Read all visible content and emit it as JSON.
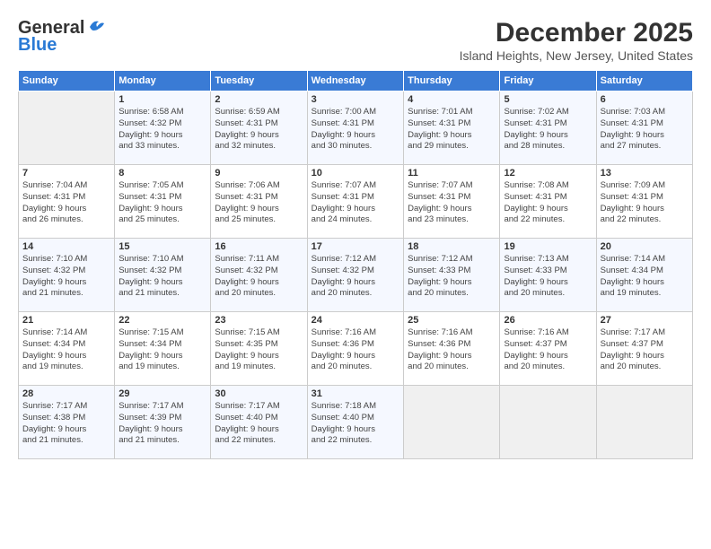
{
  "logo": {
    "general": "General",
    "blue": "Blue"
  },
  "title": "December 2025",
  "location": "Island Heights, New Jersey, United States",
  "days_of_week": [
    "Sunday",
    "Monday",
    "Tuesday",
    "Wednesday",
    "Thursday",
    "Friday",
    "Saturday"
  ],
  "weeks": [
    [
      {
        "day": "",
        "info": ""
      },
      {
        "day": "1",
        "info": "Sunrise: 6:58 AM\nSunset: 4:32 PM\nDaylight: 9 hours\nand 33 minutes."
      },
      {
        "day": "2",
        "info": "Sunrise: 6:59 AM\nSunset: 4:31 PM\nDaylight: 9 hours\nand 32 minutes."
      },
      {
        "day": "3",
        "info": "Sunrise: 7:00 AM\nSunset: 4:31 PM\nDaylight: 9 hours\nand 30 minutes."
      },
      {
        "day": "4",
        "info": "Sunrise: 7:01 AM\nSunset: 4:31 PM\nDaylight: 9 hours\nand 29 minutes."
      },
      {
        "day": "5",
        "info": "Sunrise: 7:02 AM\nSunset: 4:31 PM\nDaylight: 9 hours\nand 28 minutes."
      },
      {
        "day": "6",
        "info": "Sunrise: 7:03 AM\nSunset: 4:31 PM\nDaylight: 9 hours\nand 27 minutes."
      }
    ],
    [
      {
        "day": "7",
        "info": "Sunrise: 7:04 AM\nSunset: 4:31 PM\nDaylight: 9 hours\nand 26 minutes."
      },
      {
        "day": "8",
        "info": "Sunrise: 7:05 AM\nSunset: 4:31 PM\nDaylight: 9 hours\nand 25 minutes."
      },
      {
        "day": "9",
        "info": "Sunrise: 7:06 AM\nSunset: 4:31 PM\nDaylight: 9 hours\nand 25 minutes."
      },
      {
        "day": "10",
        "info": "Sunrise: 7:07 AM\nSunset: 4:31 PM\nDaylight: 9 hours\nand 24 minutes."
      },
      {
        "day": "11",
        "info": "Sunrise: 7:07 AM\nSunset: 4:31 PM\nDaylight: 9 hours\nand 23 minutes."
      },
      {
        "day": "12",
        "info": "Sunrise: 7:08 AM\nSunset: 4:31 PM\nDaylight: 9 hours\nand 22 minutes."
      },
      {
        "day": "13",
        "info": "Sunrise: 7:09 AM\nSunset: 4:31 PM\nDaylight: 9 hours\nand 22 minutes."
      }
    ],
    [
      {
        "day": "14",
        "info": "Sunrise: 7:10 AM\nSunset: 4:32 PM\nDaylight: 9 hours\nand 21 minutes."
      },
      {
        "day": "15",
        "info": "Sunrise: 7:10 AM\nSunset: 4:32 PM\nDaylight: 9 hours\nand 21 minutes."
      },
      {
        "day": "16",
        "info": "Sunrise: 7:11 AM\nSunset: 4:32 PM\nDaylight: 9 hours\nand 20 minutes."
      },
      {
        "day": "17",
        "info": "Sunrise: 7:12 AM\nSunset: 4:32 PM\nDaylight: 9 hours\nand 20 minutes."
      },
      {
        "day": "18",
        "info": "Sunrise: 7:12 AM\nSunset: 4:33 PM\nDaylight: 9 hours\nand 20 minutes."
      },
      {
        "day": "19",
        "info": "Sunrise: 7:13 AM\nSunset: 4:33 PM\nDaylight: 9 hours\nand 20 minutes."
      },
      {
        "day": "20",
        "info": "Sunrise: 7:14 AM\nSunset: 4:34 PM\nDaylight: 9 hours\nand 19 minutes."
      }
    ],
    [
      {
        "day": "21",
        "info": "Sunrise: 7:14 AM\nSunset: 4:34 PM\nDaylight: 9 hours\nand 19 minutes."
      },
      {
        "day": "22",
        "info": "Sunrise: 7:15 AM\nSunset: 4:34 PM\nDaylight: 9 hours\nand 19 minutes."
      },
      {
        "day": "23",
        "info": "Sunrise: 7:15 AM\nSunset: 4:35 PM\nDaylight: 9 hours\nand 19 minutes."
      },
      {
        "day": "24",
        "info": "Sunrise: 7:16 AM\nSunset: 4:36 PM\nDaylight: 9 hours\nand 20 minutes."
      },
      {
        "day": "25",
        "info": "Sunrise: 7:16 AM\nSunset: 4:36 PM\nDaylight: 9 hours\nand 20 minutes."
      },
      {
        "day": "26",
        "info": "Sunrise: 7:16 AM\nSunset: 4:37 PM\nDaylight: 9 hours\nand 20 minutes."
      },
      {
        "day": "27",
        "info": "Sunrise: 7:17 AM\nSunset: 4:37 PM\nDaylight: 9 hours\nand 20 minutes."
      }
    ],
    [
      {
        "day": "28",
        "info": "Sunrise: 7:17 AM\nSunset: 4:38 PM\nDaylight: 9 hours\nand 21 minutes."
      },
      {
        "day": "29",
        "info": "Sunrise: 7:17 AM\nSunset: 4:39 PM\nDaylight: 9 hours\nand 21 minutes."
      },
      {
        "day": "30",
        "info": "Sunrise: 7:17 AM\nSunset: 4:40 PM\nDaylight: 9 hours\nand 22 minutes."
      },
      {
        "day": "31",
        "info": "Sunrise: 7:18 AM\nSunset: 4:40 PM\nDaylight: 9 hours\nand 22 minutes."
      },
      {
        "day": "",
        "info": ""
      },
      {
        "day": "",
        "info": ""
      },
      {
        "day": "",
        "info": ""
      }
    ]
  ]
}
